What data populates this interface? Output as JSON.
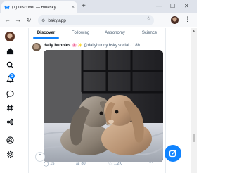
{
  "browser": {
    "tab_title": "(1) Discover — Bluesky",
    "url": "bsky.app",
    "new_tab": "+",
    "close_tab": "×",
    "minimize": "—",
    "maximize": "☐",
    "close_window": "✕"
  },
  "app": {
    "notification_count": "1",
    "feed_tabs": [
      "Discover",
      "Following",
      "Astronomy",
      "Science"
    ],
    "active_tab": "Discover",
    "post": {
      "display_name": "daily bunnies 🌸✨",
      "handle": "@dailybunny.bsky.social",
      "time": "· 18h",
      "replies": "15",
      "reposts": "80",
      "likes": "1.2K",
      "more": "···"
    }
  },
  "colors": {
    "accent": "#1083fe",
    "tab_bar": "#dfe3eb",
    "muted_text": "#6f869f"
  }
}
